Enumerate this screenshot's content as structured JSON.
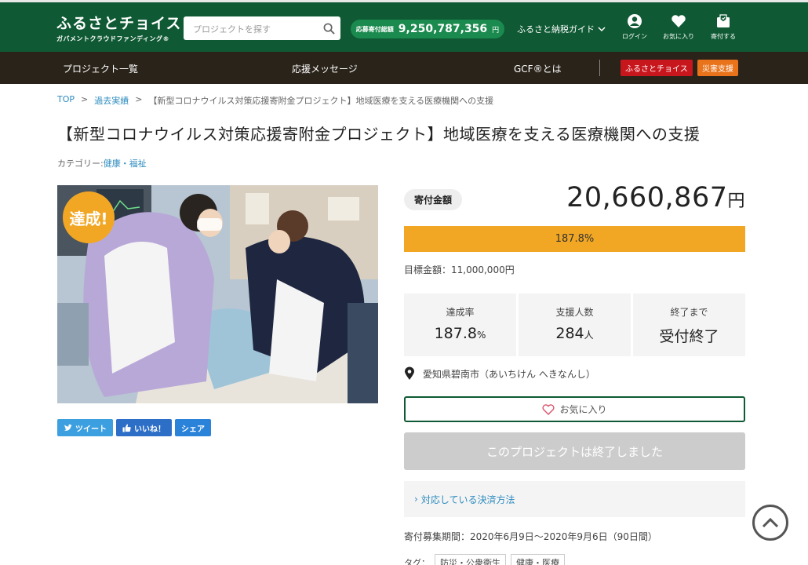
{
  "header": {
    "logo_main": "ふるさとチョイス",
    "logo_sub": "ガバメントクラウドファンディング®",
    "search_placeholder": "プロジェクトを探す",
    "total_label": "応募寄付総額",
    "total_amount": "9,250,787,356",
    "total_unit": "円",
    "guide": "ふるさと納税ガイド",
    "icons": [
      {
        "label": "ログイン",
        "icon": "user-icon"
      },
      {
        "label": "お気に入り",
        "icon": "heart-icon"
      },
      {
        "label": "寄付する",
        "icon": "donate-icon"
      }
    ]
  },
  "nav": {
    "items": [
      "プロジェクト一覧",
      "応援メッセージ",
      "GCF®とは"
    ],
    "badges": [
      {
        "label": "ふるさとチョイス",
        "color": "#c8161d"
      },
      {
        "label": "災害支援",
        "color": "#e8731b"
      }
    ]
  },
  "breadcrumb": [
    "TOP",
    ">",
    "過去実績",
    ">",
    "【新型コロナウイルス対策応援寄附金プロジェクト】地域医療を支える医療機関への支援"
  ],
  "title": "【新型コロナウイルス対策応援寄附金プロジェクト】地域医療を支える医療機関への支援",
  "category_label": "カテゴリー:",
  "category_value": "健康・福祉",
  "photo_badge": "達成!",
  "social": [
    {
      "label": "ツイート",
      "color": "#3b9fe0"
    },
    {
      "label": "いいね！",
      "color": "#2d6fc7"
    },
    {
      "label": "シェア",
      "color": "#2a82d9"
    }
  ],
  "donation": {
    "label": "寄付金額",
    "amount": "20,660,867",
    "unit": "円",
    "progress_text": "187.8%",
    "progress_fraction": 1.0,
    "target": "目標金額：11,000,000円"
  },
  "stats": [
    {
      "label": "達成率",
      "value": "187.8",
      "unit": "%"
    },
    {
      "label": "支援人数",
      "value": "284",
      "unit": "人"
    },
    {
      "label": "終了まで",
      "value": "受付終了",
      "unit": ""
    }
  ],
  "location": "愛知県碧南市（あいちけん へきなんし）",
  "favorite_label": "お気に入り",
  "ended_label": "このプロジェクトは終了しました",
  "payment_label": "対応している決済方法",
  "period": "寄付募集期間：2020年6月9日～2020年9月6日（90日間）",
  "tags_label": "タグ：",
  "tags": [
    "防災・公衆衛生",
    "健康・医療"
  ],
  "colors": {
    "header_green": "#0f5a34",
    "accent_orange": "#f1a724",
    "link_blue": "#2d8bbf"
  }
}
